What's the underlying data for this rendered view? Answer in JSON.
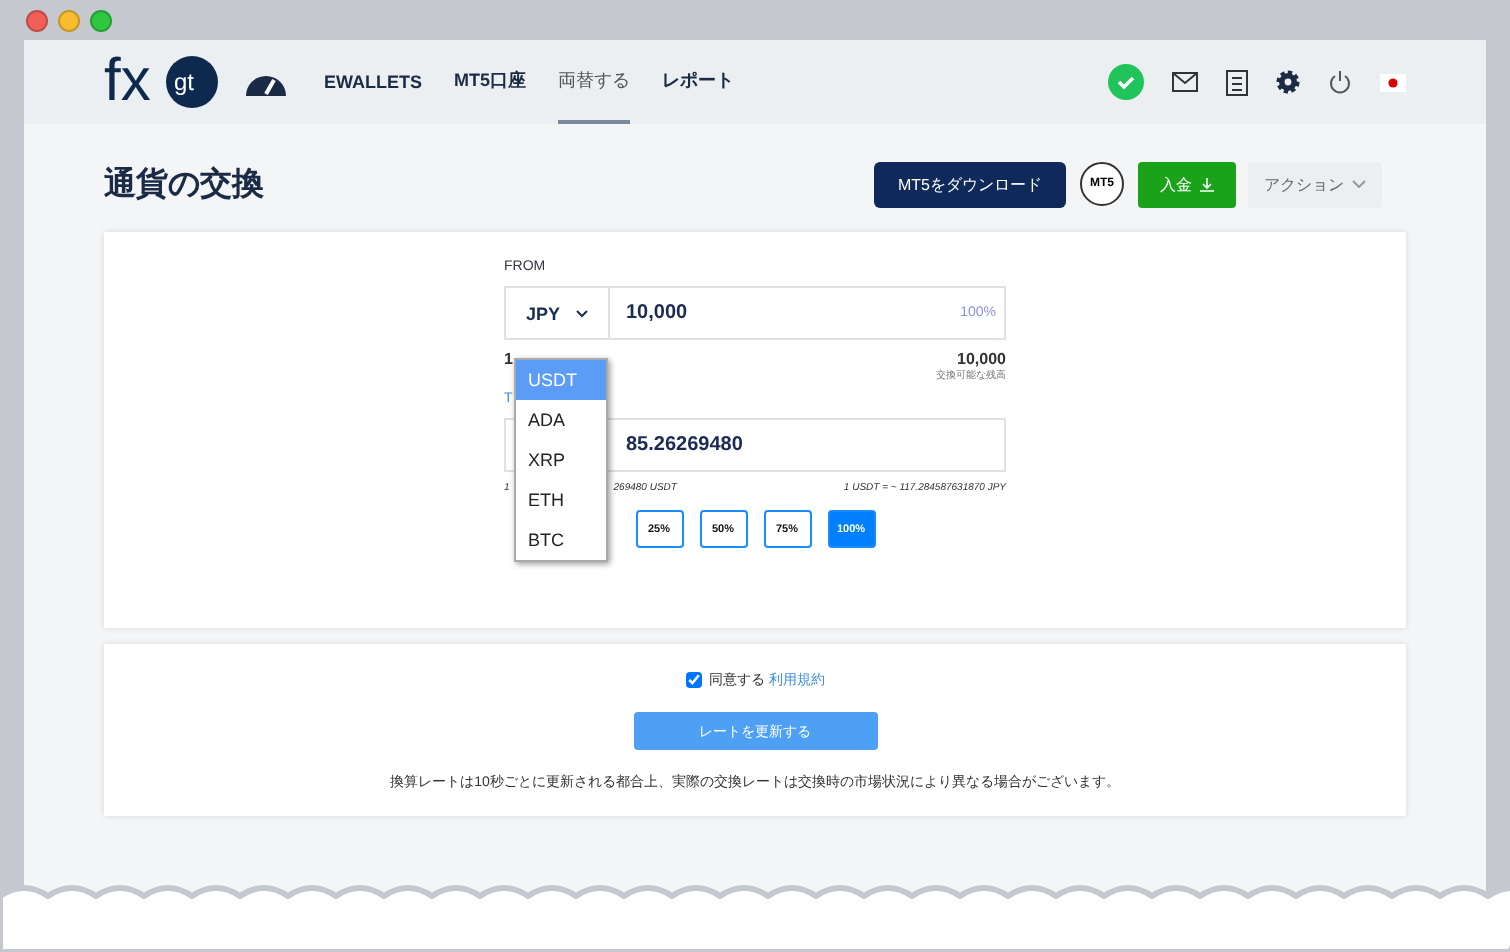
{
  "logo": {
    "left": "fx",
    "right": "gt"
  },
  "nav": {
    "items": [
      {
        "label": "EWALLETS",
        "selected": false
      },
      {
        "label": "MT5口座",
        "selected": false
      },
      {
        "label": "両替する",
        "selected": true
      },
      {
        "label": "レポート",
        "selected": false
      }
    ]
  },
  "header": {
    "title": "通貨の交換",
    "download_button": "MT5をダウンロード",
    "mt5_badge": "MT5",
    "deposit_button": "入金",
    "action_select": "アクション"
  },
  "from": {
    "label": "FROM",
    "currency": "JPY",
    "amount": "10,000",
    "percent": "100%",
    "balance_left": "1",
    "balance": "10,000",
    "balance_caption": "交換可能な残高"
  },
  "dropdown": {
    "options": [
      {
        "label": "USDT",
        "selected": true
      },
      {
        "label": "ADA",
        "selected": false
      },
      {
        "label": "XRP",
        "selected": false
      },
      {
        "label": "ETH",
        "selected": false
      },
      {
        "label": "BTC",
        "selected": false
      }
    ]
  },
  "to": {
    "label": "T",
    "amount": "85.26269480",
    "rate_left_prefix": "1",
    "rate_left": "269480 USDT",
    "rate_right": "1 USDT = ~ 117.284587631870 JPY"
  },
  "percent_buttons": [
    {
      "label": "25%",
      "selected": false
    },
    {
      "label": "50%",
      "selected": false
    },
    {
      "label": "75%",
      "selected": false
    },
    {
      "label": "100%",
      "selected": true
    }
  ],
  "agreement": {
    "checked": true,
    "label": "同意する",
    "link": "利用規約"
  },
  "refresh_button": "レートを更新する",
  "notice": "換算レートは10秒ごとに更新される都合上、実際の交換レートは交換時の市場状況により異なる場合がございます。"
}
